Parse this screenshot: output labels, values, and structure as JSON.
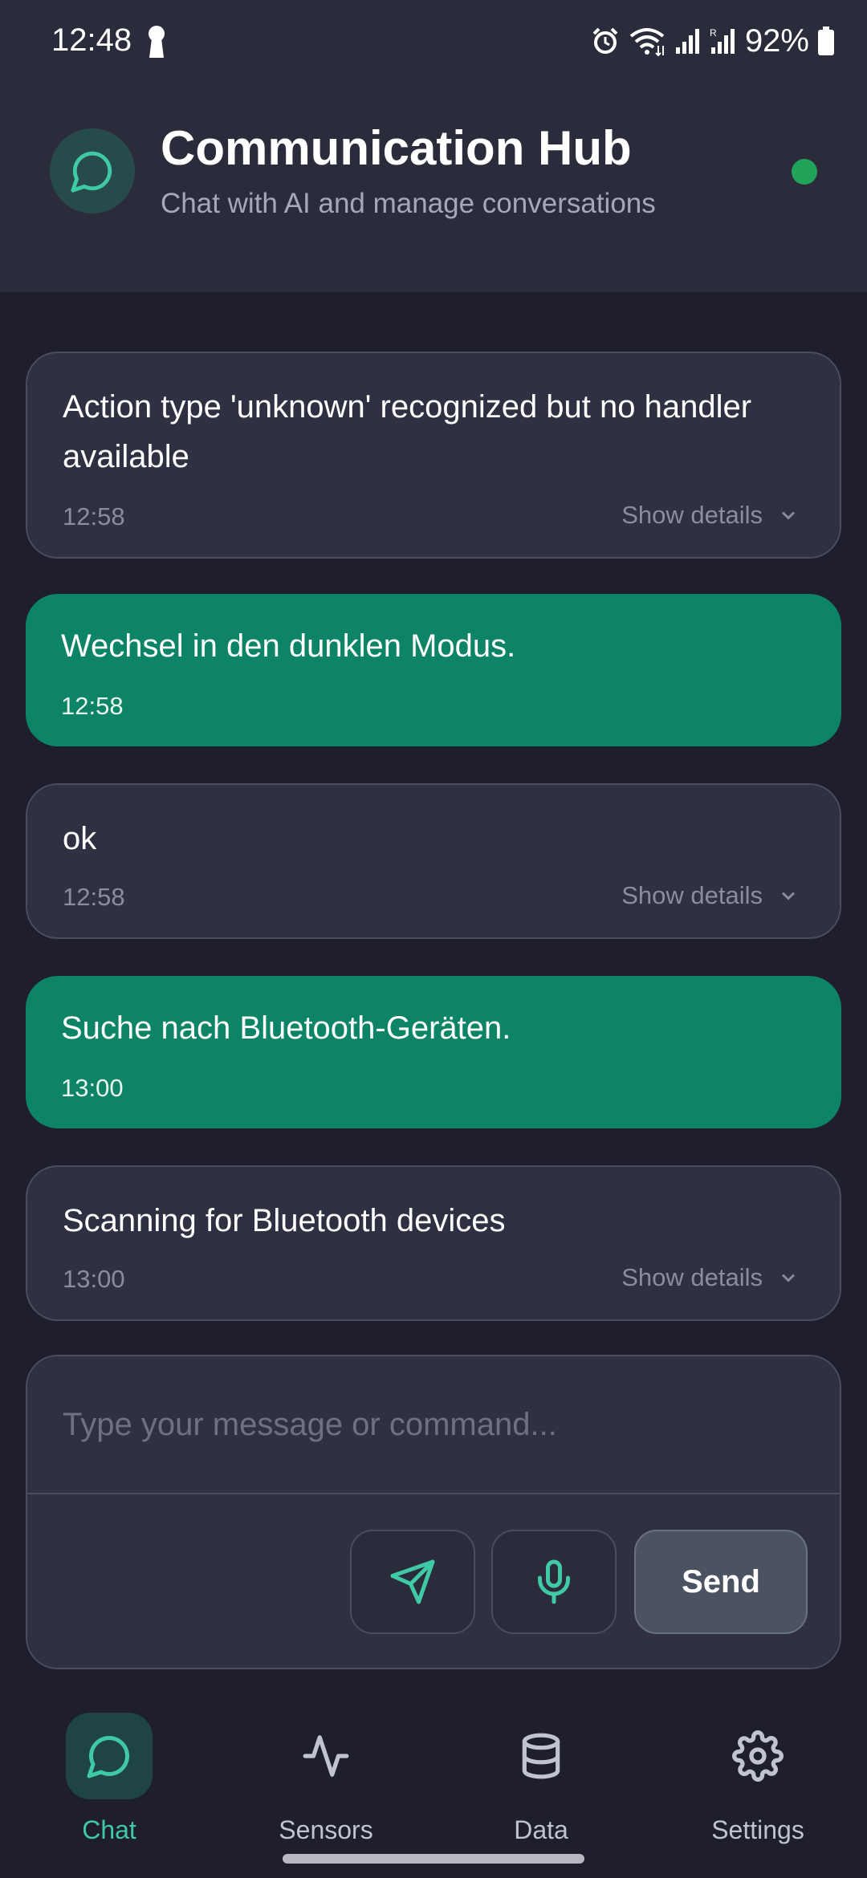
{
  "status_bar": {
    "time": "12:48",
    "battery": "92%",
    "icons": [
      "keyhole-icon",
      "alarm-icon",
      "wifi-icon",
      "signal-icon",
      "signal-r-icon",
      "battery-icon"
    ]
  },
  "header": {
    "title": "Communication Hub",
    "subtitle": "Chat with AI and manage conversations",
    "icon": "chat-bubble-icon",
    "status_color": "#22a35a"
  },
  "messages": [
    {
      "type": "system",
      "text": "Action type 'unknown' recognized but no handler available",
      "time": "12:58",
      "details_label": "Show details"
    },
    {
      "type": "user",
      "text": "Wechsel in den dunklen Modus.",
      "time": "12:58"
    },
    {
      "type": "system",
      "text": "ok",
      "time": "12:58",
      "details_label": "Show details"
    },
    {
      "type": "user",
      "text": "Suche nach Bluetooth-Geräten.",
      "time": "13:00"
    },
    {
      "type": "system",
      "text": "Scanning for Bluetooth devices",
      "time": "13:00",
      "details_label": "Show details"
    }
  ],
  "composer": {
    "placeholder": "Type your message or command...",
    "send_label": "Send"
  },
  "nav": {
    "items": [
      {
        "label": "Chat",
        "icon": "chat-bubble-icon",
        "active": true
      },
      {
        "label": "Sensors",
        "icon": "activity-icon",
        "active": false
      },
      {
        "label": "Data",
        "icon": "database-icon",
        "active": false
      },
      {
        "label": "Settings",
        "icon": "gear-icon",
        "active": false
      }
    ]
  },
  "colors": {
    "background": "#1e1e2c",
    "header": "#2b2c3b",
    "user_bubble": "#0d8466",
    "accent": "#3fc9a4"
  }
}
